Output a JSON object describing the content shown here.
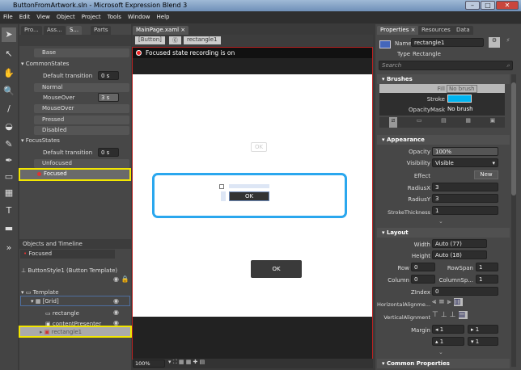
{
  "window": {
    "title": "ButtonFromArtwork.sln - Microsoft Expression Blend 3"
  },
  "menu": [
    "File",
    "Edit",
    "View",
    "Object",
    "Project",
    "Tools",
    "Window",
    "Help"
  ],
  "left_tabs": [
    "Pro...",
    "Ass...",
    "S...",
    "Parts"
  ],
  "states": {
    "base": "Base",
    "common": "CommonStates",
    "default_transition": "Default transition",
    "zero": "0 s",
    "normal": "Normal",
    "mouseover_transition": "MouseOver",
    "three": "3 s",
    "mouseover": "MouseOver",
    "pressed": "Pressed",
    "disabled": "Disabled",
    "focus": "FocusStates",
    "unfocused": "Unfocused",
    "focused": "Focused"
  },
  "objects": {
    "header": "Objects and Timeline",
    "current_state": "Focused",
    "style": "ButtonStyle1 (Button Template)",
    "items": [
      "Template",
      "[Grid]",
      "rectangle",
      "contentPresenter",
      "rectangle1"
    ]
  },
  "doc": {
    "tab": "MainPage.xaml",
    "breadcrumb": [
      "[Button]",
      "rectangle1"
    ],
    "recording": "Focused state recording is on",
    "ok": "OK",
    "zoom": "100%"
  },
  "right_tabs": [
    "Properties",
    "Resources",
    "Data"
  ],
  "props": {
    "name_label": "Name",
    "name": "rectangle1",
    "type_label": "Type",
    "type": "Rectangle",
    "search": "Search",
    "brushes": "Brushes",
    "fill": "Fill",
    "fill_val": "No brush",
    "stroke": "Stroke",
    "opacity_mask": "OpacityMask",
    "om_val": "No brush",
    "stroke_color": "#00b4f0",
    "appearance": "Appearance",
    "opacity": "Opacity",
    "opacity_val": "100%",
    "visibility": "Visibility",
    "visibility_val": "Visible",
    "effect": "Effect",
    "new": "New",
    "radiusx": "RadiusX",
    "radiusx_val": "3",
    "radiusy": "RadiusY",
    "radiusy_val": "3",
    "st": "StrokeThickness",
    "st_val": "1",
    "layout": "Layout",
    "width": "Width",
    "width_val": "Auto (77)",
    "height": "Height",
    "height_val": "Auto (18)",
    "row": "Row",
    "row_val": "0",
    "rowspan": "RowSpan",
    "rowspan_val": "1",
    "column": "Column",
    "column_val": "0",
    "colspan": "ColumnSp...",
    "colspan_val": "1",
    "zindex": "ZIndex",
    "zindex_val": "0",
    "halign": "HorizontalAlignme...",
    "valign": "VerticalAlignment",
    "margin": "Margin",
    "m": [
      "1",
      "1",
      "1",
      "1"
    ],
    "common": "Common Properties"
  }
}
